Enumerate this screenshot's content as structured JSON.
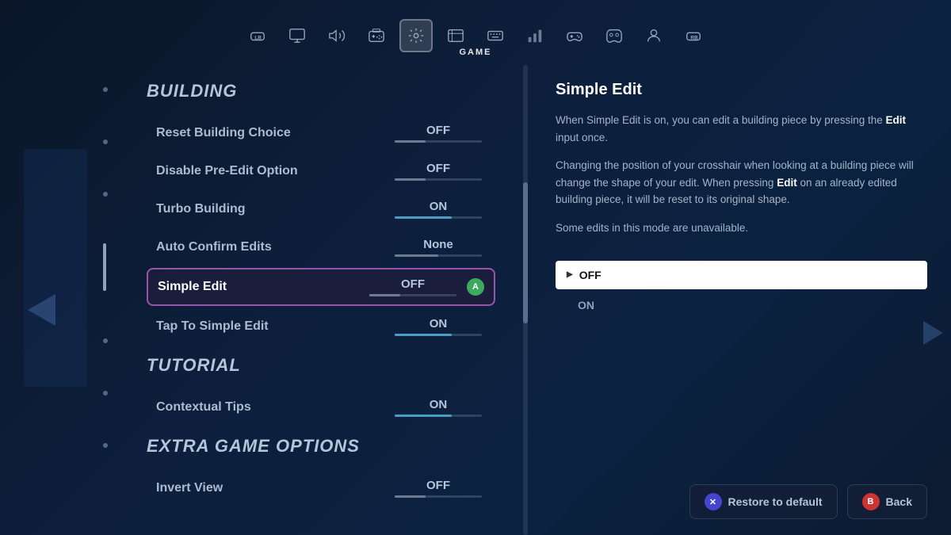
{
  "nav": {
    "tabs": [
      {
        "id": "lb",
        "label": "LB",
        "icon": "⬜",
        "active": false
      },
      {
        "id": "monitor",
        "label": "Monitor",
        "icon": "🖥",
        "active": false
      },
      {
        "id": "audio",
        "label": "Audio",
        "icon": "🔊",
        "active": false
      },
      {
        "id": "controller",
        "label": "Controller",
        "icon": "🎮",
        "active": false
      },
      {
        "id": "game",
        "label": "GAME",
        "icon": "⚙",
        "active": true
      },
      {
        "id": "hud",
        "label": "HUD",
        "icon": "📺",
        "active": false
      },
      {
        "id": "keyboard",
        "label": "Keyboard",
        "icon": "⌨",
        "active": false
      },
      {
        "id": "stats",
        "label": "Stats",
        "icon": "📊",
        "active": false
      },
      {
        "id": "gamepad",
        "label": "Gamepad",
        "icon": "🎮",
        "active": false
      },
      {
        "id": "gamepad2",
        "label": "Gamepad2",
        "icon": "🕹",
        "active": false
      },
      {
        "id": "profile",
        "label": "Profile",
        "icon": "👤",
        "active": false
      },
      {
        "id": "rb",
        "label": "RB",
        "icon": "⬜",
        "active": false
      }
    ],
    "active_label": "GAME"
  },
  "building_section": {
    "title": "BUILDING",
    "settings": [
      {
        "name": "Reset Building Choice",
        "value": "OFF",
        "slider": "off"
      },
      {
        "name": "Disable Pre-Edit Option",
        "value": "OFF",
        "slider": "off"
      },
      {
        "name": "Turbo Building",
        "value": "ON",
        "slider": "on"
      },
      {
        "name": "Auto Confirm Edits",
        "value": "None",
        "slider": "none"
      },
      {
        "name": "Simple Edit",
        "value": "OFF",
        "slider": "off",
        "active": true
      },
      {
        "name": "Tap To Simple Edit",
        "value": "ON",
        "slider": "on"
      }
    ]
  },
  "tutorial_section": {
    "title": "TUTORIAL",
    "settings": [
      {
        "name": "Contextual Tips",
        "value": "ON",
        "slider": "on"
      }
    ]
  },
  "extra_section": {
    "title": "EXTRA GAME OPTIONS",
    "settings": [
      {
        "name": "Invert View",
        "value": "OFF",
        "slider": "off"
      }
    ]
  },
  "info_panel": {
    "title": "Simple Edit",
    "paragraphs": [
      "When Simple Edit is on, you can edit a building piece by pressing the {Edit} input once.",
      "Changing the position of your crosshair when looking at a building piece will change the shape of your edit. When pressing {Edit} on an already edited building piece, it will be reset to its original shape.",
      "Some edits in this mode are unavailable."
    ],
    "dropdown": {
      "options": [
        {
          "label": "OFF",
          "selected": true
        },
        {
          "label": "ON",
          "selected": false
        }
      ]
    }
  },
  "buttons": {
    "restore": "Restore to default",
    "back": "Back"
  }
}
